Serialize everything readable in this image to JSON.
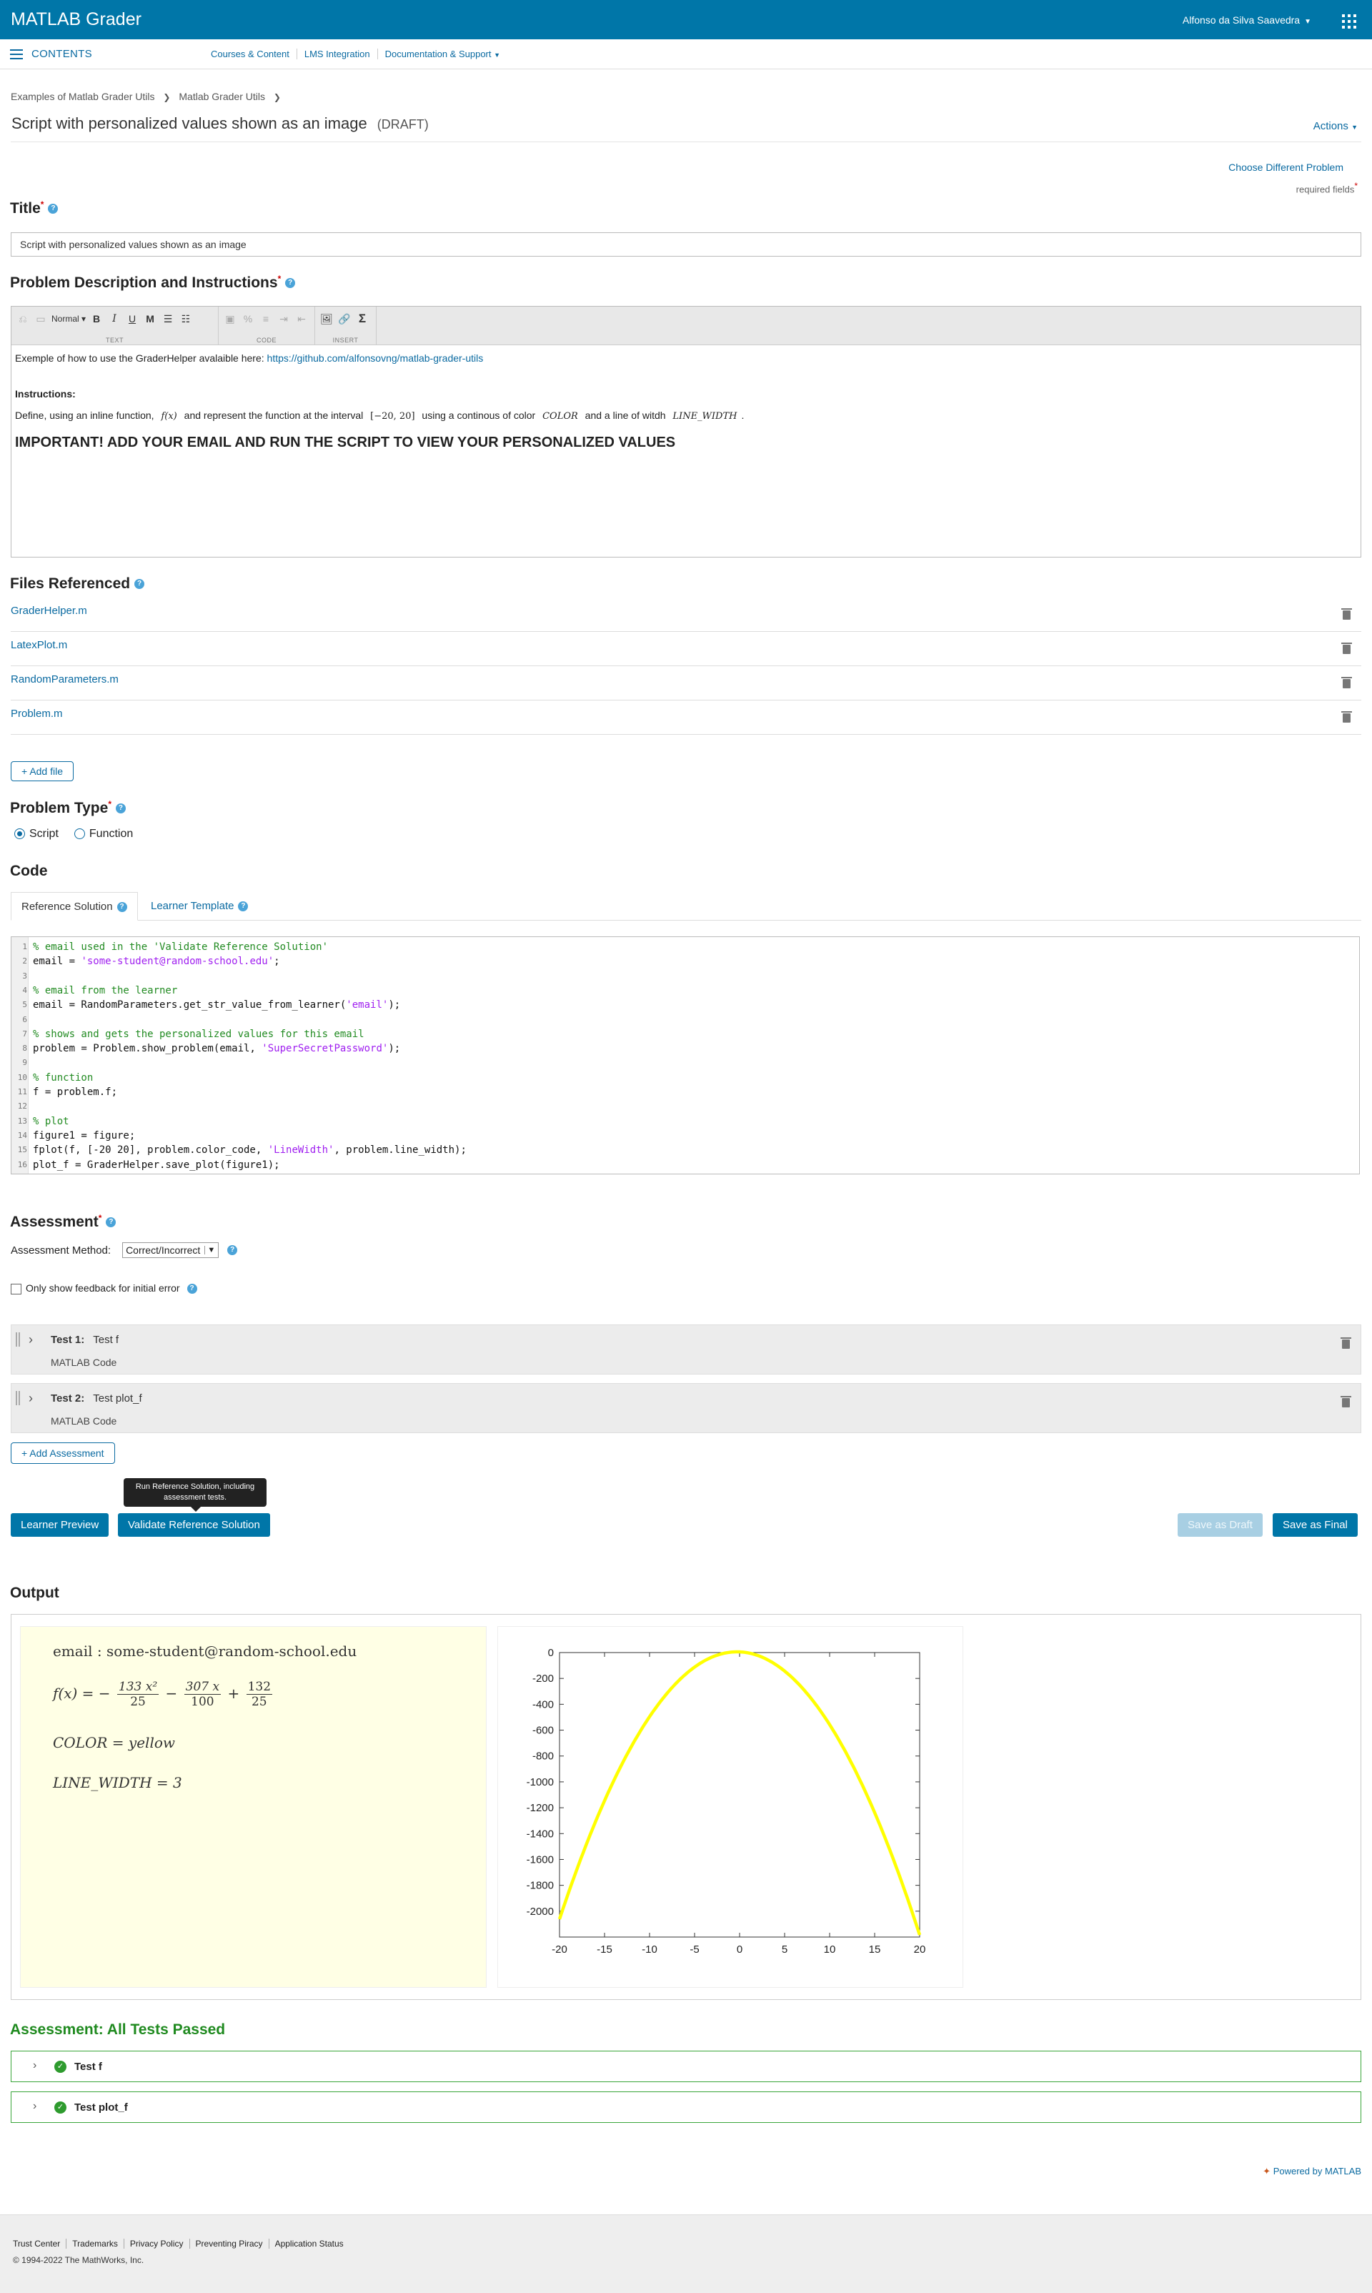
{
  "header": {
    "brand": "MATLAB Grader",
    "user": "Alfonso da Silva Saavedra"
  },
  "subnav": {
    "contents": "CONTENTS",
    "links": [
      "Courses & Content",
      "LMS Integration",
      "Documentation & Support"
    ]
  },
  "breadcrumb": [
    "Examples of Matlab Grader Utils",
    "Matlab Grader Utils"
  ],
  "page": {
    "title": "Script with personalized values shown as an image",
    "status": "(DRAFT)",
    "actions": "Actions",
    "choose_problem": "Choose Different Problem",
    "required_fields": "required fields"
  },
  "title_section": {
    "heading": "Title",
    "value": "Script with personalized values shown as an image"
  },
  "description_section": {
    "heading": "Problem Description and Instructions",
    "toolbar": {
      "style": "Normal",
      "groups": [
        "TEXT",
        "CODE",
        "INSERT"
      ]
    },
    "intro": "Exemple of how to use the GraderHelper avalaible here: ",
    "link": "https://github.com/alfonsovng/matlab-grader-utils",
    "instructions_label": "Instructions:",
    "instr_a": "Define, using an inline function, ",
    "instr_fx": "f(x)",
    "instr_b": " and represent the function at the interval ",
    "instr_interval": "[−20, 20]",
    "instr_c": " using a continous of color ",
    "instr_color": "COLOR",
    "instr_d": " and a line of witdh ",
    "instr_width": "LINE_WIDTH",
    "instr_e": ".",
    "important": "IMPORTANT! ADD YOUR EMAIL AND RUN THE SCRIPT TO VIEW YOUR PERSONALIZED VALUES"
  },
  "files_section": {
    "heading": "Files Referenced",
    "files": [
      "GraderHelper.m",
      "LatexPlot.m",
      "RandomParameters.m",
      "Problem.m"
    ],
    "add_file": "Add file"
  },
  "problem_type": {
    "heading": "Problem Type",
    "options": [
      "Script",
      "Function"
    ],
    "selected": "Script"
  },
  "code_section": {
    "heading": "Code",
    "tabs": [
      "Reference Solution",
      "Learner Template"
    ],
    "lines": [
      {
        "n": "1",
        "parts": [
          {
            "t": "% email used in the 'Validate Reference Solution'",
            "c": "cm"
          }
        ]
      },
      {
        "n": "2",
        "parts": [
          {
            "t": "email = ",
            "c": ""
          },
          {
            "t": "'some-student@random-school.edu'",
            "c": "st"
          },
          {
            "t": ";",
            "c": ""
          }
        ]
      },
      {
        "n": "3",
        "parts": []
      },
      {
        "n": "4",
        "parts": [
          {
            "t": "% email from the learner",
            "c": "cm"
          }
        ]
      },
      {
        "n": "5",
        "parts": [
          {
            "t": "email = RandomParameters.get_str_value_from_learner(",
            "c": ""
          },
          {
            "t": "'email'",
            "c": "st"
          },
          {
            "t": ");",
            "c": ""
          }
        ]
      },
      {
        "n": "6",
        "parts": []
      },
      {
        "n": "7",
        "parts": [
          {
            "t": "% shows and gets the personalized values for this email",
            "c": "cm"
          }
        ]
      },
      {
        "n": "8",
        "parts": [
          {
            "t": "problem = Problem.show_problem(email, ",
            "c": ""
          },
          {
            "t": "'SuperSecretPassword'",
            "c": "st"
          },
          {
            "t": ");",
            "c": ""
          }
        ]
      },
      {
        "n": "9",
        "parts": []
      },
      {
        "n": "10",
        "parts": [
          {
            "t": "% function",
            "c": "cm"
          }
        ]
      },
      {
        "n": "11",
        "parts": [
          {
            "t": "f = problem.f;",
            "c": ""
          }
        ]
      },
      {
        "n": "12",
        "parts": []
      },
      {
        "n": "13",
        "parts": [
          {
            "t": "% plot",
            "c": "cm"
          }
        ]
      },
      {
        "n": "14",
        "parts": [
          {
            "t": "figure1 = figure;",
            "c": ""
          }
        ]
      },
      {
        "n": "15",
        "parts": [
          {
            "t": "fplot(f, [-20 20], problem.color_code, ",
            "c": ""
          },
          {
            "t": "'LineWidth'",
            "c": "st"
          },
          {
            "t": ", problem.line_width);",
            "c": ""
          }
        ]
      },
      {
        "n": "16",
        "parts": [
          {
            "t": "plot_f = GraderHelper.save_plot(figure1);",
            "c": ""
          }
        ]
      }
    ]
  },
  "assessment_section": {
    "heading": "Assessment",
    "method_label": "Assessment Method:",
    "method_value": "Correct/Incorrect",
    "feedback_label": "Only show feedback for initial error",
    "tests": [
      {
        "label": "Test 1:",
        "name": "Test f",
        "type": "MATLAB Code"
      },
      {
        "label": "Test 2:",
        "name": "Test plot_f",
        "type": "MATLAB Code"
      }
    ],
    "add_assessment": "+ Add Assessment"
  },
  "buttons": {
    "tooltip": "Run Reference Solution, including assessment tests.",
    "learner_preview": "Learner Preview",
    "validate": "Validate Reference Solution",
    "save_draft": "Save as Draft",
    "save_final": "Save as Final"
  },
  "output": {
    "heading": "Output",
    "email_label": "email",
    "email_value": "some-student@random-school.edu",
    "f_lhs": "f(x) = −",
    "frac1_num": "133 x²",
    "frac1_den": "25",
    "frac2_num": "307 x",
    "frac2_den": "100",
    "frac3_num": "132",
    "frac3_den": "25",
    "color_eq": "COLOR = yellow",
    "width_eq": "LINE_WIDTH = 3"
  },
  "chart_data": {
    "type": "line",
    "function": "-133/25*x^2 - 307/100*x + 132/25",
    "x_range": [
      -20,
      20
    ],
    "xlim": [
      -20,
      20
    ],
    "ylim": [
      -2200,
      0
    ],
    "x_ticks": [
      -20,
      -15,
      -10,
      -5,
      0,
      5,
      10,
      15,
      20
    ],
    "y_ticks": [
      0,
      -200,
      -400,
      -600,
      -800,
      -1000,
      -1200,
      -1400,
      -1600,
      -1800,
      -2000
    ],
    "line_color": "#ffff00",
    "line_width": 3,
    "grid": false,
    "title": "",
    "xlabel": "",
    "ylabel": ""
  },
  "results": {
    "heading": "Assessment: All Tests Passed",
    "tests": [
      "Test f",
      "Test plot_f"
    ]
  },
  "footer": {
    "powered": "Powered by MATLAB",
    "links": [
      "Trust Center",
      "Trademarks",
      "Privacy Policy",
      "Preventing Piracy",
      "Application Status"
    ],
    "copyright": "© 1994-2022 The MathWorks, Inc."
  },
  "colors": {
    "brand": "#0076a8",
    "link": "#0a6aa1",
    "success": "#1f8a1f",
    "output_bg": "#ffffe5"
  }
}
